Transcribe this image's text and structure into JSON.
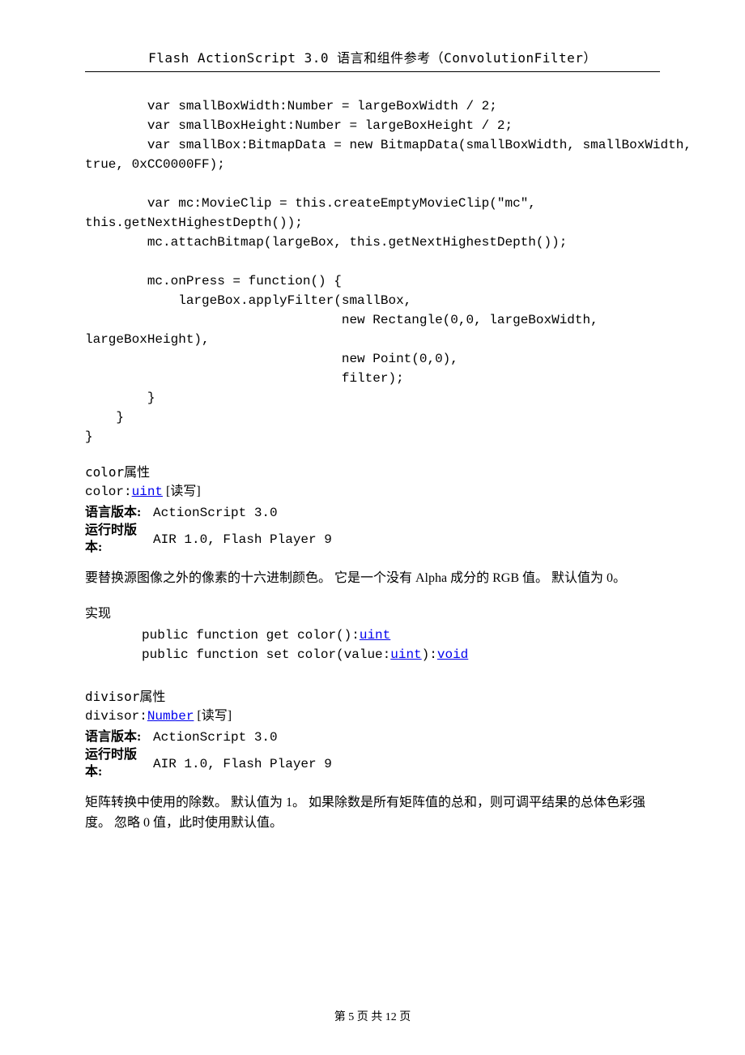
{
  "header": "Flash ActionScript 3.0 语言和组件参考（ConvolutionFilter）",
  "code": "        var smallBoxWidth:Number = largeBoxWidth / 2;\n        var smallBoxHeight:Number = largeBoxHeight / 2;\n        var smallBox:BitmapData = new BitmapData(smallBoxWidth, smallBoxWidth,\ntrue, 0xCC0000FF);\n\n        var mc:MovieClip = this.createEmptyMovieClip(\"mc\",\nthis.getNextHighestDepth());\n        mc.attachBitmap(largeBox, this.getNextHighestDepth());\n\n        mc.onPress = function() {\n            largeBox.applyFilter(smallBox,\n                                 new Rectangle(0,0, largeBoxWidth,\nlargeBoxHeight),\n                                 new Point(0,0),\n                                 filter);\n        }\n    }\n}",
  "color": {
    "title": "color属性  ",
    "sig_prefix": "color:",
    "sig_type": "uint",
    "rw": "  [读写]",
    "lang_label": "语言版本:",
    "lang_value": "ActionScript 3.0",
    "runtime_label": "运行时版本:",
    "runtime_value": "AIR 1.0, Flash Player 9",
    "desc": "要替换源图像之外的像素的十六进制颜色。 它是一个没有 Alpha 成分的 RGB 值。 默认值为 0。",
    "impl_label": "实现",
    "impl_get_a": "public function get color():",
    "impl_get_b": "uint",
    "impl_set_a": "public function set color(value:",
    "impl_set_b": "uint",
    "impl_set_c": "):",
    "impl_set_d": "void"
  },
  "divisor": {
    "title": "divisor属性  ",
    "sig_prefix": "divisor:",
    "sig_type": "Number",
    "rw": "  [读写]",
    "lang_label": "语言版本:",
    "lang_value": "ActionScript 3.0",
    "runtime_label": "运行时版本:",
    "runtime_value": "AIR 1.0, Flash Player 9",
    "desc": "矩阵转换中使用的除数。 默认值为 1。 如果除数是所有矩阵值的总和，则可调平结果的总体色彩强度。 忽略 0 值，此时使用默认值。"
  },
  "footer": "第 5 页 共 12 页"
}
